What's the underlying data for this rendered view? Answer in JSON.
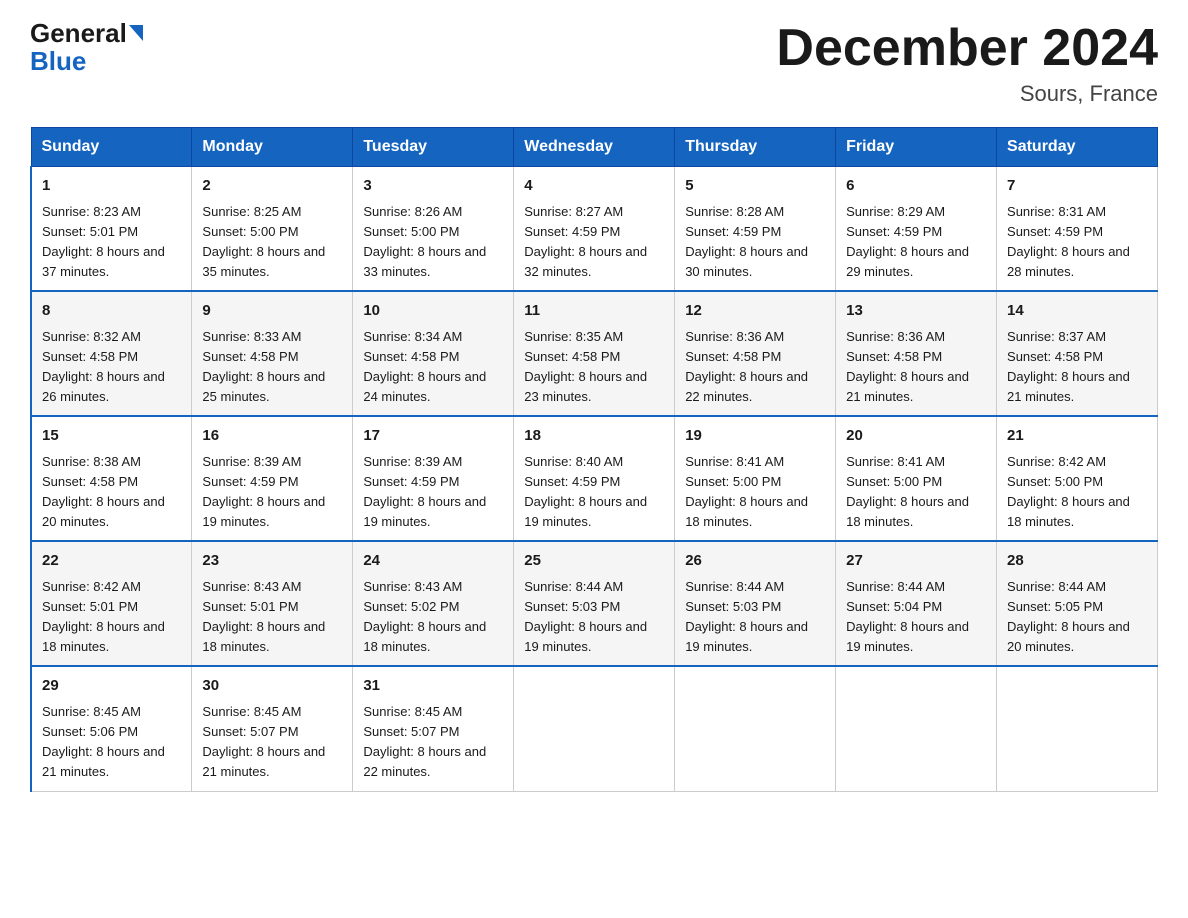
{
  "header": {
    "logo_line1": "General",
    "logo_line2": "Blue",
    "month_title": "December 2024",
    "location": "Sours, France"
  },
  "days_of_week": [
    "Sunday",
    "Monday",
    "Tuesday",
    "Wednesday",
    "Thursday",
    "Friday",
    "Saturday"
  ],
  "weeks": [
    [
      {
        "day": "1",
        "sunrise": "8:23 AM",
        "sunset": "5:01 PM",
        "daylight": "8 hours and 37 minutes."
      },
      {
        "day": "2",
        "sunrise": "8:25 AM",
        "sunset": "5:00 PM",
        "daylight": "8 hours and 35 minutes."
      },
      {
        "day": "3",
        "sunrise": "8:26 AM",
        "sunset": "5:00 PM",
        "daylight": "8 hours and 33 minutes."
      },
      {
        "day": "4",
        "sunrise": "8:27 AM",
        "sunset": "4:59 PM",
        "daylight": "8 hours and 32 minutes."
      },
      {
        "day": "5",
        "sunrise": "8:28 AM",
        "sunset": "4:59 PM",
        "daylight": "8 hours and 30 minutes."
      },
      {
        "day": "6",
        "sunrise": "8:29 AM",
        "sunset": "4:59 PM",
        "daylight": "8 hours and 29 minutes."
      },
      {
        "day": "7",
        "sunrise": "8:31 AM",
        "sunset": "4:59 PM",
        "daylight": "8 hours and 28 minutes."
      }
    ],
    [
      {
        "day": "8",
        "sunrise": "8:32 AM",
        "sunset": "4:58 PM",
        "daylight": "8 hours and 26 minutes."
      },
      {
        "day": "9",
        "sunrise": "8:33 AM",
        "sunset": "4:58 PM",
        "daylight": "8 hours and 25 minutes."
      },
      {
        "day": "10",
        "sunrise": "8:34 AM",
        "sunset": "4:58 PM",
        "daylight": "8 hours and 24 minutes."
      },
      {
        "day": "11",
        "sunrise": "8:35 AM",
        "sunset": "4:58 PM",
        "daylight": "8 hours and 23 minutes."
      },
      {
        "day": "12",
        "sunrise": "8:36 AM",
        "sunset": "4:58 PM",
        "daylight": "8 hours and 22 minutes."
      },
      {
        "day": "13",
        "sunrise": "8:36 AM",
        "sunset": "4:58 PM",
        "daylight": "8 hours and 21 minutes."
      },
      {
        "day": "14",
        "sunrise": "8:37 AM",
        "sunset": "4:58 PM",
        "daylight": "8 hours and 21 minutes."
      }
    ],
    [
      {
        "day": "15",
        "sunrise": "8:38 AM",
        "sunset": "4:58 PM",
        "daylight": "8 hours and 20 minutes."
      },
      {
        "day": "16",
        "sunrise": "8:39 AM",
        "sunset": "4:59 PM",
        "daylight": "8 hours and 19 minutes."
      },
      {
        "day": "17",
        "sunrise": "8:39 AM",
        "sunset": "4:59 PM",
        "daylight": "8 hours and 19 minutes."
      },
      {
        "day": "18",
        "sunrise": "8:40 AM",
        "sunset": "4:59 PM",
        "daylight": "8 hours and 19 minutes."
      },
      {
        "day": "19",
        "sunrise": "8:41 AM",
        "sunset": "5:00 PM",
        "daylight": "8 hours and 18 minutes."
      },
      {
        "day": "20",
        "sunrise": "8:41 AM",
        "sunset": "5:00 PM",
        "daylight": "8 hours and 18 minutes."
      },
      {
        "day": "21",
        "sunrise": "8:42 AM",
        "sunset": "5:00 PM",
        "daylight": "8 hours and 18 minutes."
      }
    ],
    [
      {
        "day": "22",
        "sunrise": "8:42 AM",
        "sunset": "5:01 PM",
        "daylight": "8 hours and 18 minutes."
      },
      {
        "day": "23",
        "sunrise": "8:43 AM",
        "sunset": "5:01 PM",
        "daylight": "8 hours and 18 minutes."
      },
      {
        "day": "24",
        "sunrise": "8:43 AM",
        "sunset": "5:02 PM",
        "daylight": "8 hours and 18 minutes."
      },
      {
        "day": "25",
        "sunrise": "8:44 AM",
        "sunset": "5:03 PM",
        "daylight": "8 hours and 19 minutes."
      },
      {
        "day": "26",
        "sunrise": "8:44 AM",
        "sunset": "5:03 PM",
        "daylight": "8 hours and 19 minutes."
      },
      {
        "day": "27",
        "sunrise": "8:44 AM",
        "sunset": "5:04 PM",
        "daylight": "8 hours and 19 minutes."
      },
      {
        "day": "28",
        "sunrise": "8:44 AM",
        "sunset": "5:05 PM",
        "daylight": "8 hours and 20 minutes."
      }
    ],
    [
      {
        "day": "29",
        "sunrise": "8:45 AM",
        "sunset": "5:06 PM",
        "daylight": "8 hours and 21 minutes."
      },
      {
        "day": "30",
        "sunrise": "8:45 AM",
        "sunset": "5:07 PM",
        "daylight": "8 hours and 21 minutes."
      },
      {
        "day": "31",
        "sunrise": "8:45 AM",
        "sunset": "5:07 PM",
        "daylight": "8 hours and 22 minutes."
      },
      {
        "day": "",
        "sunrise": "",
        "sunset": "",
        "daylight": ""
      },
      {
        "day": "",
        "sunrise": "",
        "sunset": "",
        "daylight": ""
      },
      {
        "day": "",
        "sunrise": "",
        "sunset": "",
        "daylight": ""
      },
      {
        "day": "",
        "sunrise": "",
        "sunset": "",
        "daylight": ""
      }
    ]
  ]
}
